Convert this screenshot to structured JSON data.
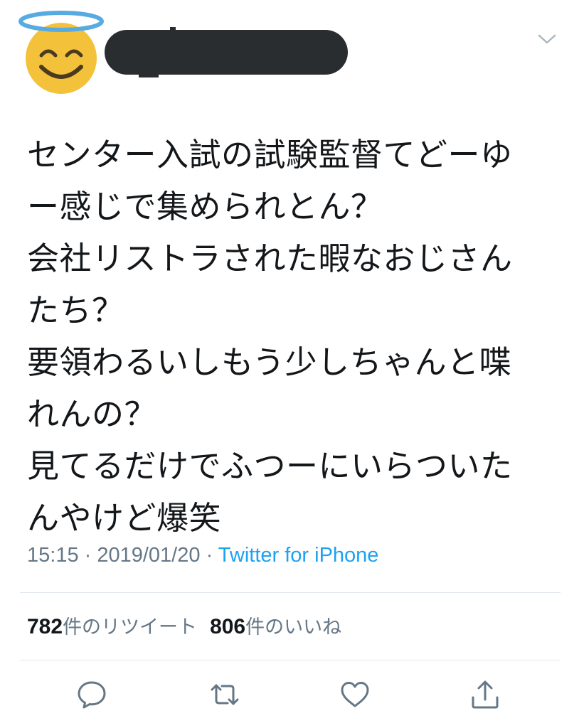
{
  "tweet": {
    "lines": [
      "センター入試の試験監督てどーゆ",
      "ー感じで集められとん？",
      "会社リストラされた暇なおじさん",
      "たち？",
      "要領わるいしもう少しちゃんと喋",
      "れんの？",
      "見てるだけでふつーにいらついた",
      "んやけど爆笑"
    ]
  },
  "meta": {
    "time": "15:15",
    "separator": " · ",
    "date": "2019/01/20",
    "source": "Twitter for iPhone"
  },
  "stats": {
    "retweet_count": "782",
    "retweet_label": "件のリツイート",
    "like_count": "806",
    "like_label": "件のいいね"
  },
  "icons": {
    "avatar": "smiling-face-with-halo-icon",
    "menu": "chevron-down-icon",
    "reply": "reply-icon",
    "retweet": "retweet-icon",
    "like": "heart-icon",
    "share": "share-icon"
  },
  "colors": {
    "text": "#14171a",
    "secondary": "#657786",
    "link": "#1da1f2",
    "divider": "#e1e8ed",
    "redaction": "#2a2d30",
    "emoji_face": "#f4c13a",
    "halo": "#57abe0"
  }
}
